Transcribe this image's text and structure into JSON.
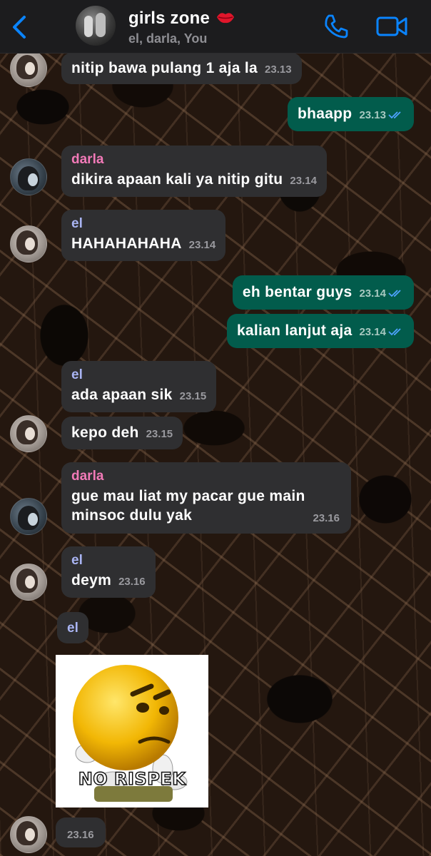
{
  "header": {
    "title": "girls zone",
    "subtitle": "el, darla, You"
  },
  "messages": [
    {
      "direction": "in",
      "sender": "",
      "text": "nitip bawa pulang 1 aja la",
      "time": "23.13"
    },
    {
      "direction": "out",
      "text": "bhaapp",
      "time": "23.13",
      "read": true
    },
    {
      "direction": "in",
      "sender": "darla",
      "text": "dikira apaan kali ya nitip gitu",
      "time": "23.14"
    },
    {
      "direction": "in",
      "sender": "el",
      "text": "HAHAHAHAHA",
      "time": "23.14"
    },
    {
      "direction": "out",
      "text": "eh bentar guys",
      "time": "23.14",
      "read": true
    },
    {
      "direction": "out",
      "text": "kalian lanjut aja",
      "time": "23.14",
      "read": true
    },
    {
      "direction": "in",
      "sender": "el",
      "text": "ada apaan sik",
      "time": "23.15"
    },
    {
      "direction": "in",
      "sender": "",
      "text": "kepo deh",
      "time": "23.15"
    },
    {
      "direction": "in",
      "sender": "darla",
      "text_line1": "gue mau liat my pacar gue main",
      "text_line2": "minsoc dulu yak",
      "time": "23.16"
    },
    {
      "direction": "in",
      "sender": "el",
      "text": "deym",
      "time": "23.16"
    },
    {
      "direction": "in",
      "sender": "el",
      "type": "sticker",
      "sticker_text": "NO RISPEK",
      "time": "23.16"
    }
  ],
  "colors": {
    "incoming_bubble": "#2f2f31",
    "outgoing_bubble": "#025c4c",
    "sender_el": "#a9b4f2",
    "sender_darla": "#f27ab8",
    "accent": "#0a84ff"
  },
  "icons": {
    "back": "chevron-left-icon",
    "call": "phone-icon",
    "video": "video-camera-icon",
    "emoji": "kiss-lips-icon",
    "read": "double-check-icon"
  }
}
